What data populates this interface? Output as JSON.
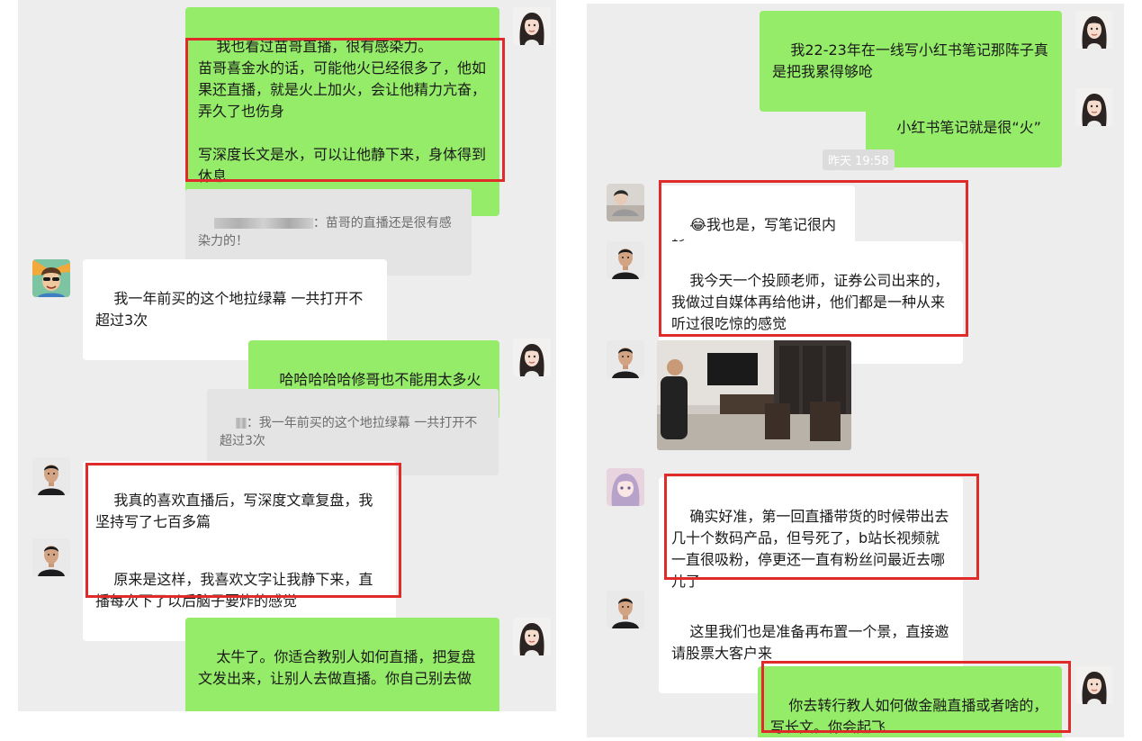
{
  "left": {
    "messages": [
      {
        "text": "我也看过苗哥直播，很有感染力。\n苗哥喜金水的话，可能他火已经很多了，他如果还直播，就是火上加火，会让他精力亢奋，弄久了也伤身\n\n写深度长文是水，可以让他静下来，身体得到休息"
      },
      {
        "text": "：苗哥的直播还是很有感染力的！"
      },
      {
        "text": "我一年前买的这个地拉绿幕 一共打开不超过3次"
      },
      {
        "text": "哈哈哈哈哈修哥也不能用太多火"
      },
      {
        "text": "：我一年前买的这个地拉绿幕 一共打开不超过3次"
      },
      {
        "text": "我真的喜欢直播后，写深度文章复盘，我坚持写了七百多篇"
      },
      {
        "text": "原来是这样，我喜欢文字让我静下来，直播每次下了以后脑子要炸的感觉"
      },
      {
        "text": "太牛了。你适合教别人如何直播，把复盘文发出来，让别人去做直播。你自己别去做"
      }
    ]
  },
  "right": {
    "timestamp": "昨天 19:58",
    "messages": [
      {
        "text": "我22-23年在一线写小红书笔记那阵子真是把我累得够呛"
      },
      {
        "text": "小红书笔记就是很“火”"
      },
      {
        "emoji": "😂",
        "text": "我也是，写笔记很内耗"
      },
      {
        "text": "我今天一个投顾老师，证券公司出来的，我做过自媒体再给他讲，他们都是一种从来听过很吃惊的感觉"
      },
      {
        "text": "确实好准，第一回直播带货的时候带出去几十个数码产品，但号死了，b站长视频就一直很吸粉，停更还一直有粉丝问最近去哪儿了"
      },
      {
        "text": "这里我们也是准备再布置一个景，直接邀请股票大客户来"
      },
      {
        "text": "你去转行教人如何做金融直播或者啥的，写长文。你会起飞"
      }
    ]
  },
  "colors": {
    "my_bubble": "#95ec69",
    "their_bubble": "#ffffff",
    "highlight": "#e02b2b",
    "background": "#ededed"
  }
}
